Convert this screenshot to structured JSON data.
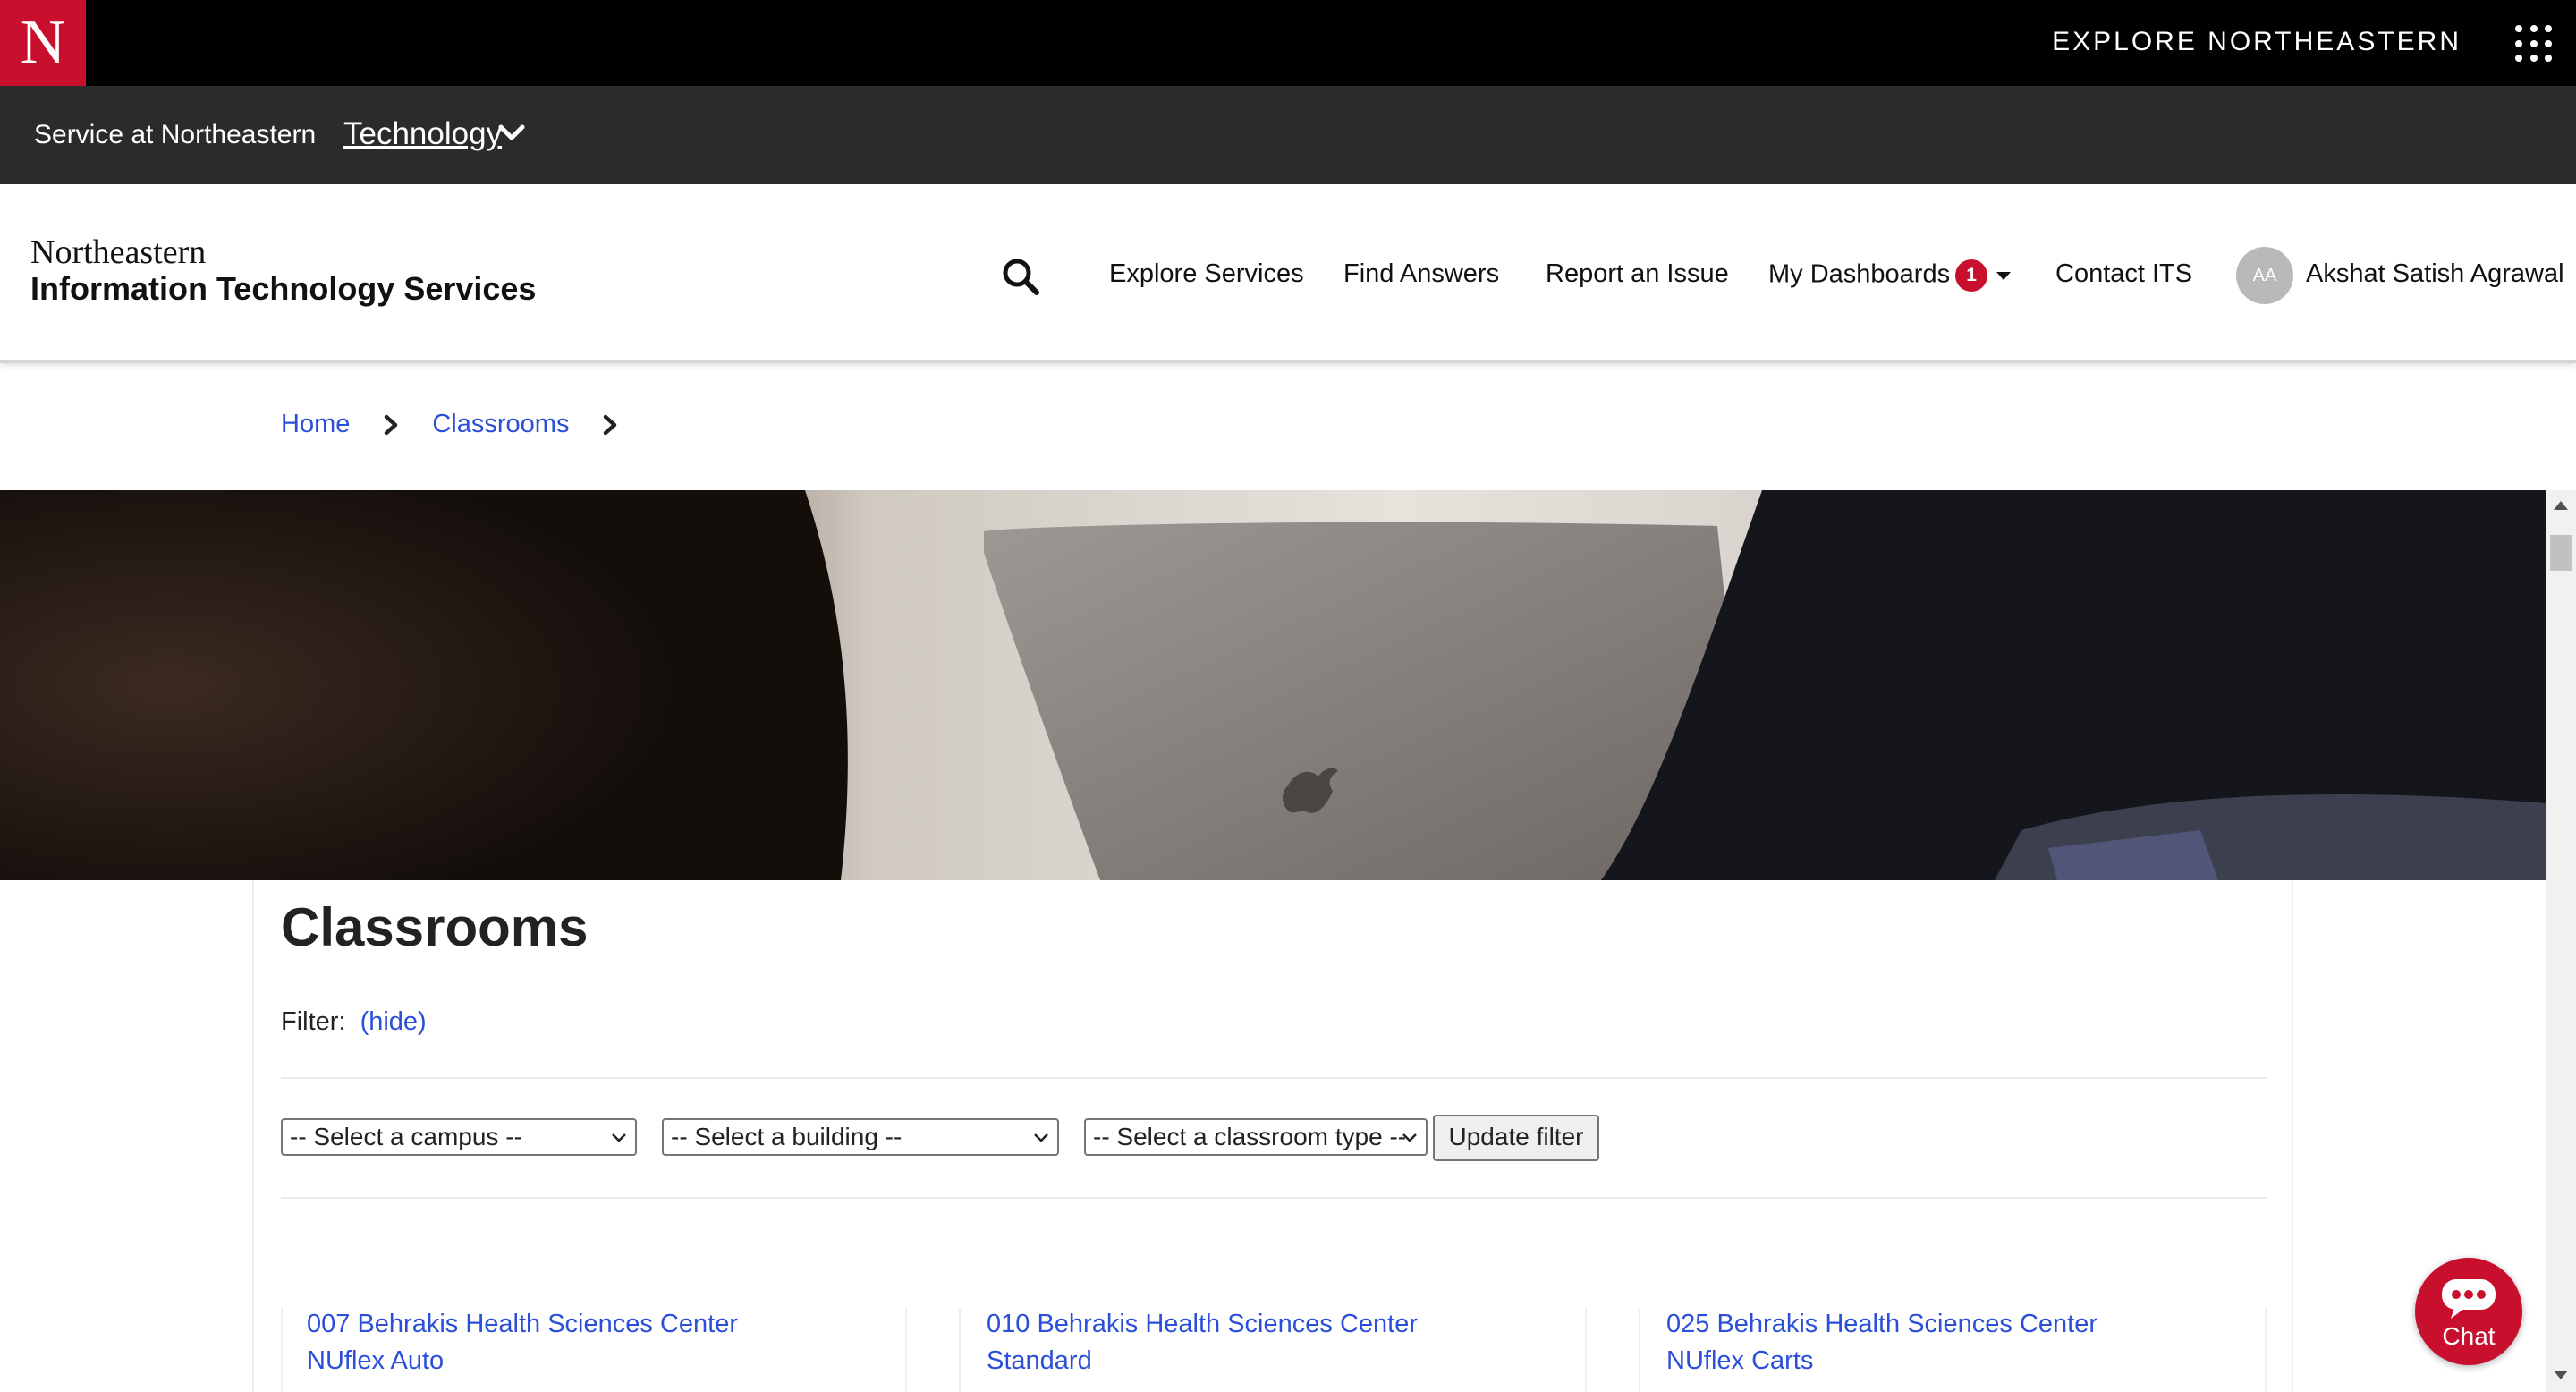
{
  "topbar": {
    "logo_letter": "N",
    "explore_label": "EXPLORE NORTHEASTERN",
    "apps_icon": "grid-icon"
  },
  "servicebar": {
    "service_label": "Service at Northeastern",
    "technology_label": "Technology"
  },
  "header": {
    "brand_line1": "Northeastern",
    "brand_line2": "Information Technology Services",
    "nav": {
      "explore_services": "Explore Services",
      "find_answers": "Find Answers",
      "report_issue": "Report an Issue",
      "my_dashboards": "My Dashboards",
      "dashboards_badge": "1",
      "contact_its": "Contact ITS"
    },
    "user": {
      "initials": "AA",
      "name": "Akshat Satish Agrawal"
    }
  },
  "breadcrumb": {
    "home": "Home",
    "classrooms": "Classrooms"
  },
  "main": {
    "title": "Classrooms",
    "filter_label": "Filter:",
    "filter_toggle": "(hide)",
    "selects": {
      "campus": "-- Select a campus --",
      "building": "-- Select a building --",
      "classroom_type": "-- Select a classroom type --"
    },
    "update_filter": "Update filter",
    "rooms": [
      {
        "name": "007 Behrakis Health Sciences Center",
        "type": "NUflex Auto"
      },
      {
        "name": "010 Behrakis Health Sciences Center",
        "type": "Standard"
      },
      {
        "name": "025 Behrakis Health Sciences Center",
        "type": "NUflex Carts"
      }
    ]
  },
  "chat": {
    "label": "Chat"
  },
  "colors": {
    "brand_red": "#c8102e",
    "link_blue": "#2b4fd8",
    "topbar_black": "#000000",
    "servicebar_grey": "#2b2b2b"
  }
}
